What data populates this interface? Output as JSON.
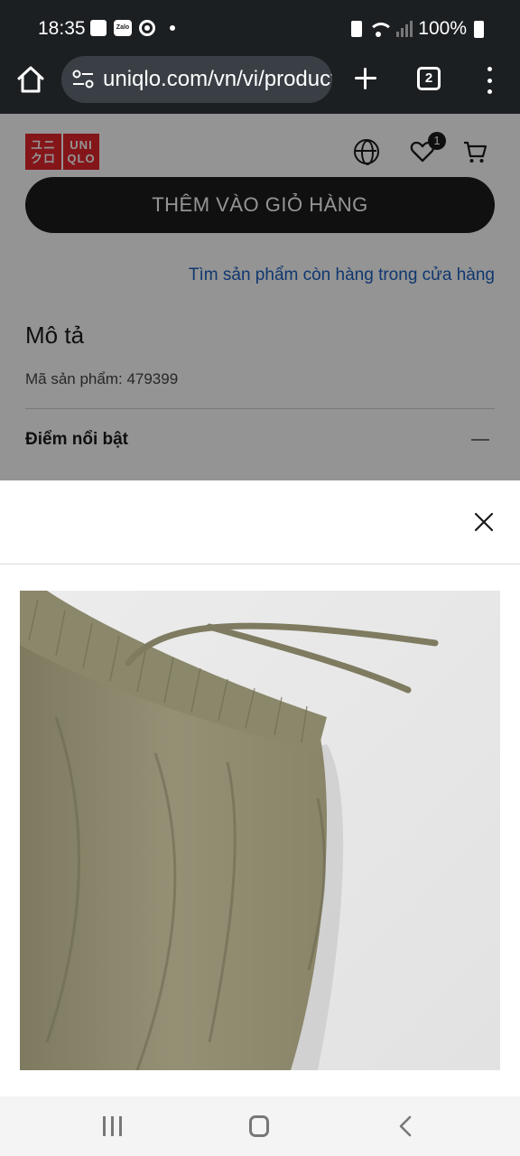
{
  "status_bar": {
    "time": "18:35",
    "zalo_icon_label": "Zalo",
    "battery": "100%",
    "icons": [
      "gallery-icon",
      "zalo-icon",
      "chrome-icon",
      "notification-dot",
      "battery-saver-icon",
      "wifi-icon",
      "signal-icon",
      "battery-icon"
    ]
  },
  "browser": {
    "url": "uniqlo.com/vn/vi/products",
    "tab_count": "2"
  },
  "site_header": {
    "logo": [
      "ユニ",
      "クロ",
      "UNI",
      "QLO"
    ],
    "wishlist_count": "1"
  },
  "product_page": {
    "add_to_cart_label": "THÊM VÀO GIỎ HÀNG",
    "store_stock_link": "Tìm sản phẩm còn hàng trong cửa hàng",
    "description_title": "Mô tả",
    "sku_text": "Mã sản phẩm: 479399",
    "highlights_title": "Điểm nổi bật"
  },
  "colors": {
    "status_bar_bg": "#1c1f22",
    "brand_red": "#e4262d",
    "link_blue": "#1b5fbf",
    "button_dark": "#1c1c1c",
    "product_olive": "#8f8a6e"
  }
}
